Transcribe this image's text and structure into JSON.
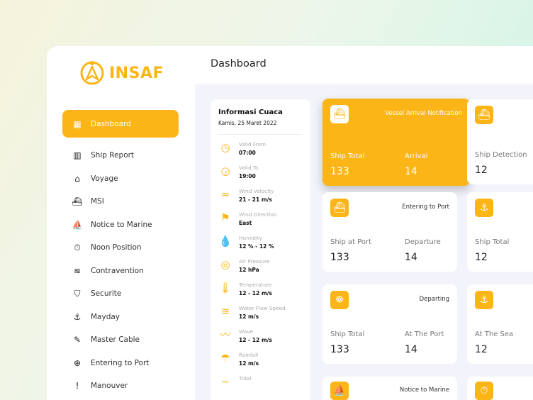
{
  "brand": "INSAF",
  "header": {
    "title": "Dashboard"
  },
  "sidebar": {
    "items": [
      {
        "label": "Dashboard",
        "icon": "grid-icon"
      },
      {
        "label": "Ship Report",
        "icon": "chart-icon"
      },
      {
        "label": "Voyage",
        "icon": "compass-icon"
      },
      {
        "label": "MSI",
        "icon": "ship-icon"
      },
      {
        "label": "Notice to Marine",
        "icon": "sailboat-icon"
      },
      {
        "label": "Noon Position",
        "icon": "clock-icon"
      },
      {
        "label": "Contravention",
        "icon": "wreck-icon"
      },
      {
        "label": "Securite",
        "icon": "shield-icon"
      },
      {
        "label": "Mayday",
        "icon": "sinking-icon"
      },
      {
        "label": "Master Cable",
        "icon": "cable-icon"
      },
      {
        "label": "Entering to Port",
        "icon": "lifebuoy-icon"
      },
      {
        "label": "Manouver",
        "icon": "alert-icon"
      }
    ]
  },
  "weather": {
    "title": "Informasi Cuaca",
    "date": "Kamis, 25 Maret 2022",
    "rows": [
      {
        "label": "Valid From",
        "value": "07:00"
      },
      {
        "label": "Valid To",
        "value": "19:00"
      },
      {
        "label": "Wind Velocity",
        "value": "21 - 21 m/s"
      },
      {
        "label": "Wind Direction",
        "value": "East"
      },
      {
        "label": "Humidity",
        "value": "12 % - 12 %"
      },
      {
        "label": "Air Pressure",
        "value": "12 hPa"
      },
      {
        "label": "Temperature",
        "value": "12 - 12 m/s"
      },
      {
        "label": "Water Flow Speed",
        "value": "12 m/s"
      },
      {
        "label": "Wave",
        "value": "12 - 12 m/s"
      },
      {
        "label": "Rainfall",
        "value": "12 m/s"
      },
      {
        "label": "Tidal",
        "value": ""
      }
    ]
  },
  "cards": [
    {
      "title": "Vessel Arrival Notification",
      "stats": [
        {
          "label": "Ship Total",
          "value": "133"
        },
        {
          "label": "Arrival",
          "value": "14"
        }
      ]
    },
    {
      "title": "",
      "stats": [
        {
          "label": "Ship Detection",
          "value": "12"
        }
      ]
    },
    {
      "title": "Entering to Port",
      "stats": [
        {
          "label": "Ship at Port",
          "value": "133"
        },
        {
          "label": "Departure",
          "value": "14"
        }
      ]
    },
    {
      "title": "",
      "stats": [
        {
          "label": "Ship Total",
          "value": "12"
        }
      ]
    },
    {
      "title": "Departing",
      "stats": [
        {
          "label": "Ship Total",
          "value": "133"
        },
        {
          "label": "At The Port",
          "value": "14"
        }
      ]
    },
    {
      "title": "",
      "stats": [
        {
          "label": "At The Sea",
          "value": "12"
        }
      ]
    },
    {
      "title": "Notice to Marine",
      "stats": []
    },
    {
      "title": "",
      "stats": []
    }
  ],
  "colors": {
    "accent": "#fbb516",
    "background": "#f3f4fb"
  }
}
